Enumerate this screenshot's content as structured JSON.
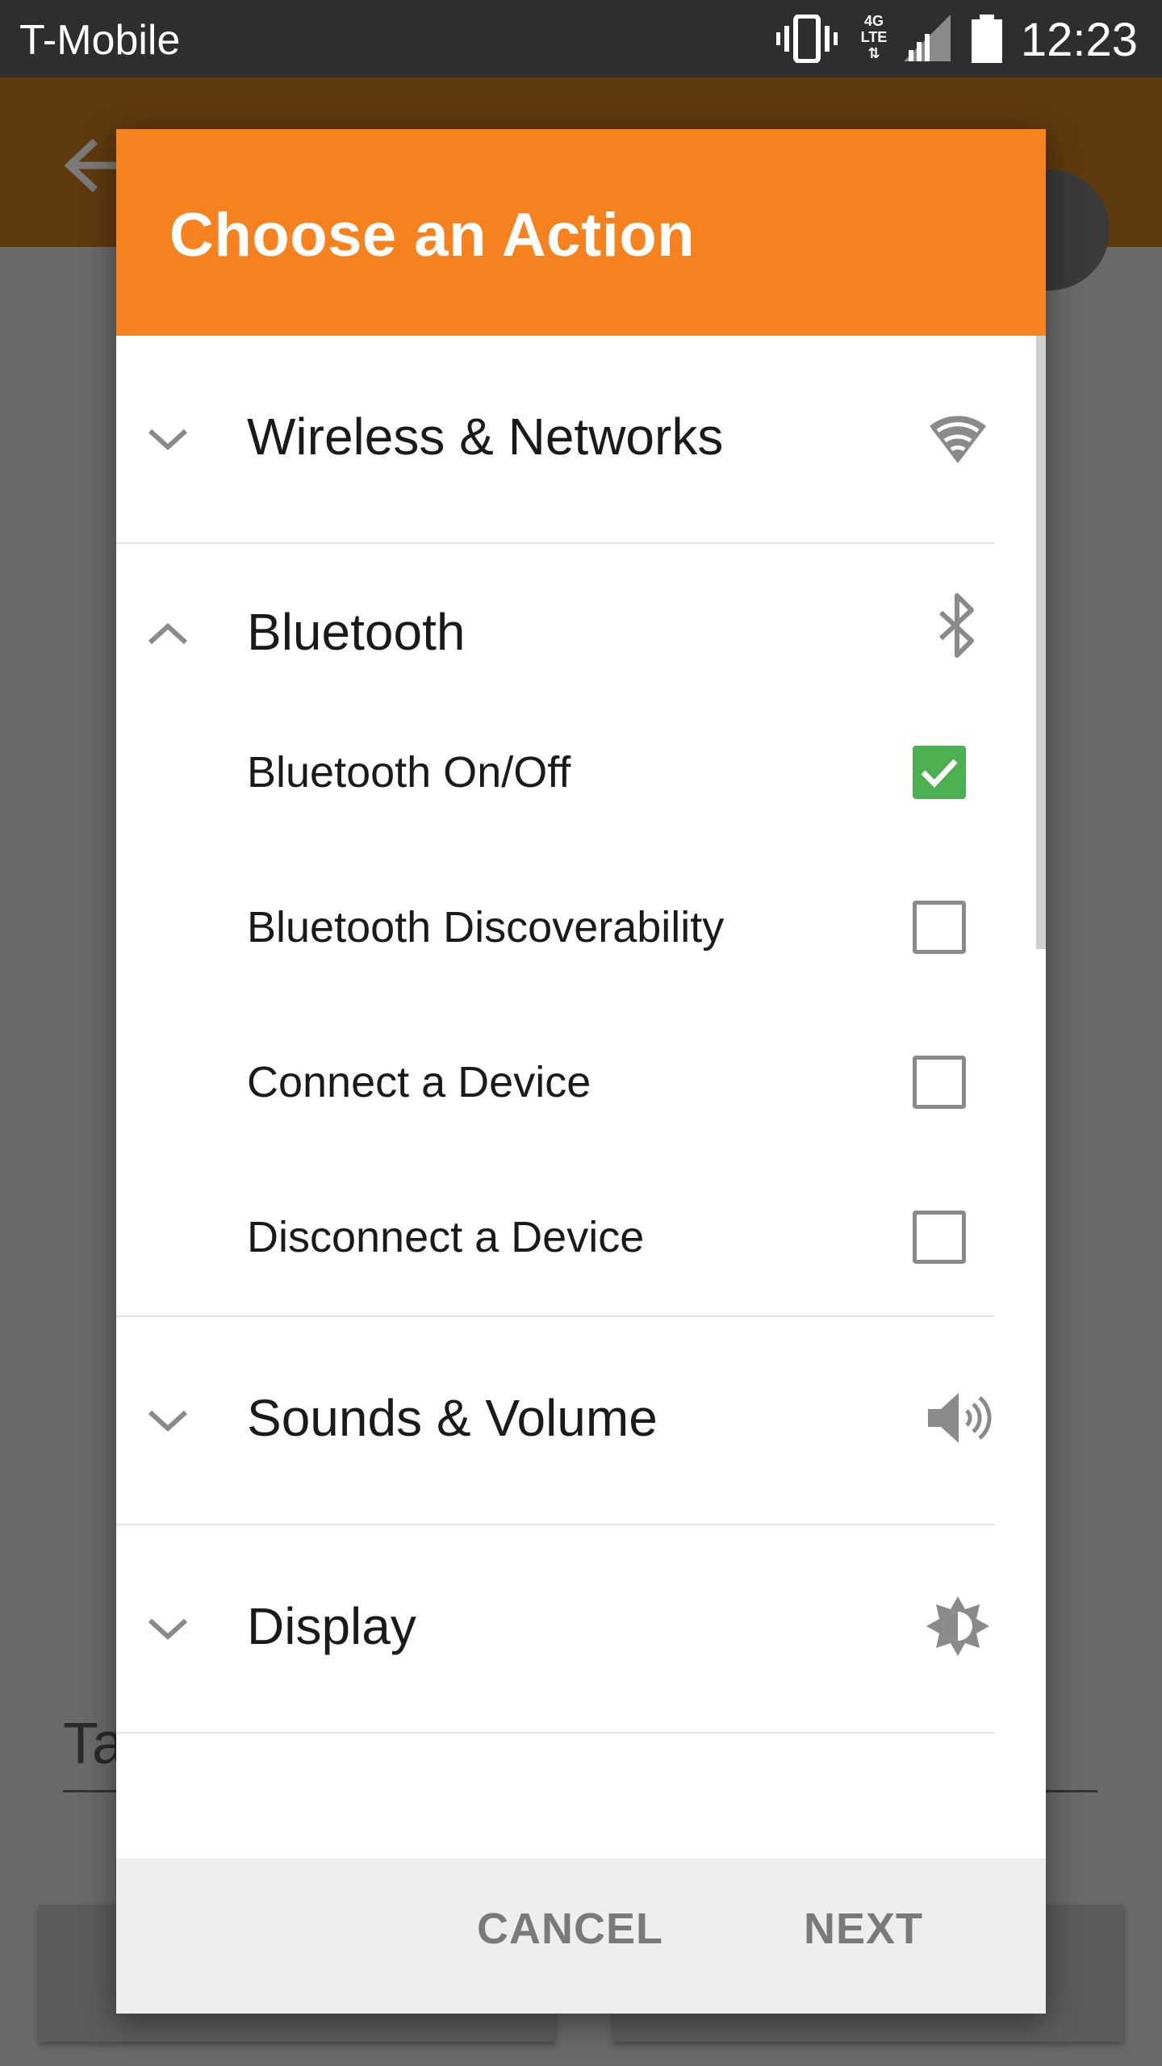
{
  "status_bar": {
    "carrier": "T-Mobile",
    "network_badge": "4G LTE",
    "time": "12:23",
    "icons": [
      "vibrate-icon",
      "network-4g-lte-icon",
      "signal-icon",
      "battery-icon"
    ]
  },
  "background": {
    "field_text": "Ta"
  },
  "dialog": {
    "title": "Choose an Action",
    "header_color": "#f5821f",
    "categories": [
      {
        "label": "Wireless & Networks",
        "icon": "wifi-icon",
        "expanded": false
      },
      {
        "label": "Bluetooth",
        "icon": "bluetooth-icon",
        "expanded": true,
        "items": [
          {
            "label": "Bluetooth On/Off",
            "checked": true
          },
          {
            "label": "Bluetooth Discoverability",
            "checked": false
          },
          {
            "label": "Connect a Device",
            "checked": false
          },
          {
            "label": "Disconnect a Device",
            "checked": false
          }
        ]
      },
      {
        "label": "Sounds & Volume",
        "icon": "speaker-icon",
        "expanded": false
      },
      {
        "label": "Display",
        "icon": "brightness-icon",
        "expanded": false
      }
    ],
    "buttons": {
      "cancel": "CANCEL",
      "next": "NEXT"
    }
  }
}
